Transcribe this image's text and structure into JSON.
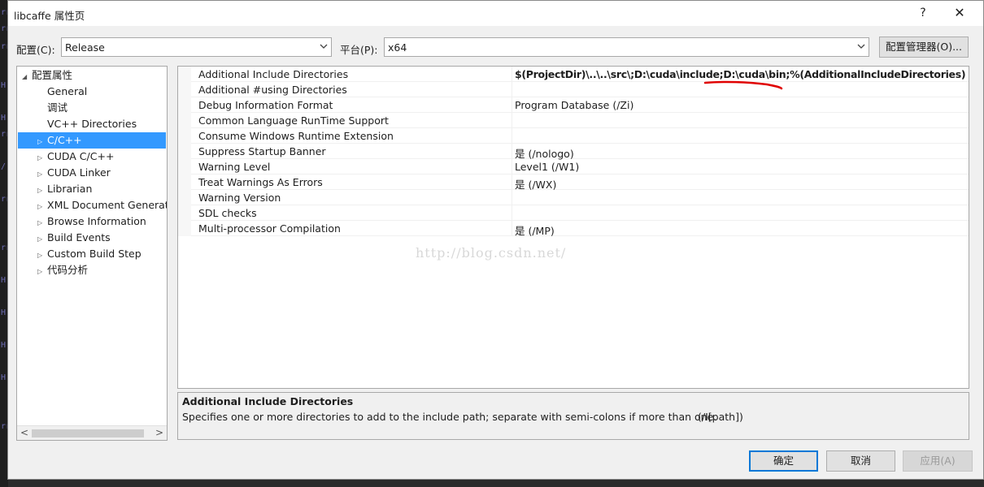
{
  "window": {
    "title": "libcaffe 属性页",
    "help_glyph": "?",
    "close_glyph": "✕"
  },
  "toolbar": {
    "config_label": "配置(C):",
    "config_value": "Release",
    "platform_label": "平台(P):",
    "platform_value": "x64",
    "config_manager_label": "配置管理器(O)..."
  },
  "tree": {
    "root": "配置属性",
    "items": [
      {
        "label": "General",
        "expandable": false
      },
      {
        "label": "调试",
        "expandable": false
      },
      {
        "label": "VC++ Directories",
        "expandable": false
      },
      {
        "label": "C/C++",
        "expandable": true,
        "selected": true
      },
      {
        "label": "CUDA C/C++",
        "expandable": true
      },
      {
        "label": "CUDA Linker",
        "expandable": true
      },
      {
        "label": "Librarian",
        "expandable": true
      },
      {
        "label": "XML Document Generat",
        "expandable": true
      },
      {
        "label": "Browse Information",
        "expandable": true
      },
      {
        "label": "Build Events",
        "expandable": true
      },
      {
        "label": "Custom Build Step",
        "expandable": true
      },
      {
        "label": "代码分析",
        "expandable": true
      }
    ],
    "collapse_glyph": "◢",
    "expand_glyph": "▷"
  },
  "properties": [
    {
      "name": "Additional Include Directories",
      "value": "$(ProjectDir)\\..\\..\\src\\;D:\\cuda\\include;D:\\cuda\\bin;%(AdditionalIncludeDirectories)",
      "bold": true
    },
    {
      "name": "Additional #using Directories",
      "value": ""
    },
    {
      "name": "Debug Information Format",
      "value": "Program Database (/Zi)"
    },
    {
      "name": "Common Language RunTime Support",
      "value": ""
    },
    {
      "name": "Consume Windows Runtime Extension",
      "value": ""
    },
    {
      "name": "Suppress Startup Banner",
      "value": "是 (/nologo)"
    },
    {
      "name": "Warning Level",
      "value": "Level1 (/W1)"
    },
    {
      "name": "Treat Warnings As Errors",
      "value": "是 (/WX)"
    },
    {
      "name": "Warning Version",
      "value": ""
    },
    {
      "name": "SDL checks",
      "value": ""
    },
    {
      "name": "Multi-processor Compilation",
      "value": "是 (/MP)"
    }
  ],
  "watermark": "http://blog.csdn.net/",
  "description": {
    "title": "Additional Include Directories",
    "text": "Specifies one or more directories to add to the include path; separate with semi-colons if more than one.",
    "switch": "(/I[path])"
  },
  "buttons": {
    "ok": "确定",
    "cancel": "取消",
    "apply": "应用(A)"
  },
  "colors": {
    "selection": "#3399ff",
    "annotation": "#e00000",
    "accent": "#0078d7"
  }
}
